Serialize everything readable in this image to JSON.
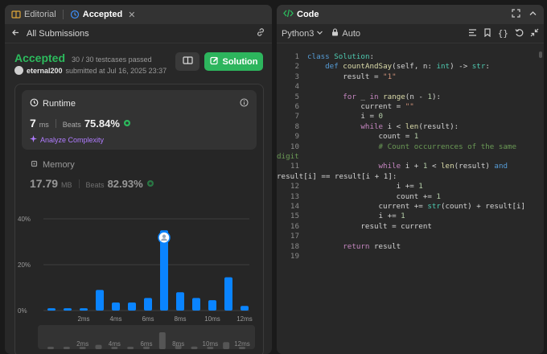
{
  "left_panel": {
    "tabs": [
      {
        "label": "Editorial",
        "icon": "book-icon"
      },
      {
        "label": "Accepted",
        "icon": "history-icon",
        "close": "✕"
      }
    ],
    "back_label": "All Submissions",
    "status": "Accepted",
    "testcases": "30 / 30 testcases passed",
    "author": "eternal200",
    "submitted_text": "submitted at Jul 16, 2025 23:37",
    "solution_button": "Solution",
    "runtime": {
      "title": "Runtime",
      "value": "7",
      "unit": "ms",
      "beats_label": "Beats",
      "beats_pct": "75.84%",
      "analyze_label": "Analyze Complexity"
    },
    "memory": {
      "title": "Memory",
      "value": "17.79",
      "unit": "MB",
      "beats_label": "Beats",
      "beats_pct": "82.93%"
    }
  },
  "chart_data": {
    "type": "bar",
    "categories": [
      "0ms",
      "1ms",
      "2ms",
      "3ms",
      "4ms",
      "5ms",
      "6ms",
      "7ms",
      "8ms",
      "9ms",
      "10ms",
      "11ms",
      "12ms"
    ],
    "values": [
      1,
      1,
      1,
      9,
      3.5,
      3.5,
      5.5,
      35,
      8,
      5.5,
      4.5,
      14.5,
      2
    ],
    "highlight_index": 7,
    "y_ticks": [
      "0%",
      "20%",
      "40%"
    ],
    "ylim": [
      0,
      40
    ],
    "x_tick_labels": [
      "2ms",
      "4ms",
      "6ms",
      "8ms",
      "10ms",
      "12ms"
    ],
    "bar_color": "#0a84ff",
    "grid": true
  },
  "code_panel": {
    "title": "Code",
    "language": "Python3",
    "auto_label": "Auto",
    "lines": [
      {
        "n": "1",
        "html": "<span class='kw'>class</span> <span class='cls'>Solution</span>:"
      },
      {
        "n": "2",
        "html": "    <span class='kw'>def</span> <span class='fn'>countAndSay</span>(self, n: <span class='bi'>int</span>) -> <span class='bi'>str</span>:"
      },
      {
        "n": "3",
        "html": "        result = <span class='str'>\"1\"</span>"
      },
      {
        "n": "4",
        "html": ""
      },
      {
        "n": "5",
        "html": "        <span class='kw2'>for</span> _ <span class='kw2'>in</span> <span class='fn'>range</span>(n - <span class='num'>1</span>):"
      },
      {
        "n": "6",
        "html": "            current = <span class='str'>\"\"</span>"
      },
      {
        "n": "7",
        "html": "            i = <span class='num'>0</span>"
      },
      {
        "n": "8",
        "html": "            <span class='kw2'>while</span> i < <span class='fn'>len</span>(result):"
      },
      {
        "n": "9",
        "html": "                count = <span class='num'>1</span>"
      },
      {
        "n": "10",
        "html": "                <span class='cm'># Count occurrences of the same</span>"
      },
      {
        "n": "",
        "html": "<span class='cm' style='margin-left:-38px'>digit</span>"
      },
      {
        "n": "11",
        "html": "                <span class='kw2'>while</span> i + <span class='num'>1</span> < <span class='fn'>len</span>(result) <span class='kw'>and</span>"
      },
      {
        "n": "",
        "html": "<span style='margin-left:-38px'>result[i] == result[i + 1]:</span>"
      },
      {
        "n": "12",
        "html": "                    i += <span class='num'>1</span>"
      },
      {
        "n": "13",
        "html": "                    count += <span class='num'>1</span>"
      },
      {
        "n": "14",
        "html": "                current += <span class='bi'>str</span>(count) + result[i]"
      },
      {
        "n": "15",
        "html": "                i += <span class='num'>1</span>"
      },
      {
        "n": "16",
        "html": "            result = current"
      },
      {
        "n": "17",
        "html": ""
      },
      {
        "n": "18",
        "html": "        <span class='kw2'>return</span> result"
      },
      {
        "n": "19",
        "html": ""
      }
    ]
  }
}
